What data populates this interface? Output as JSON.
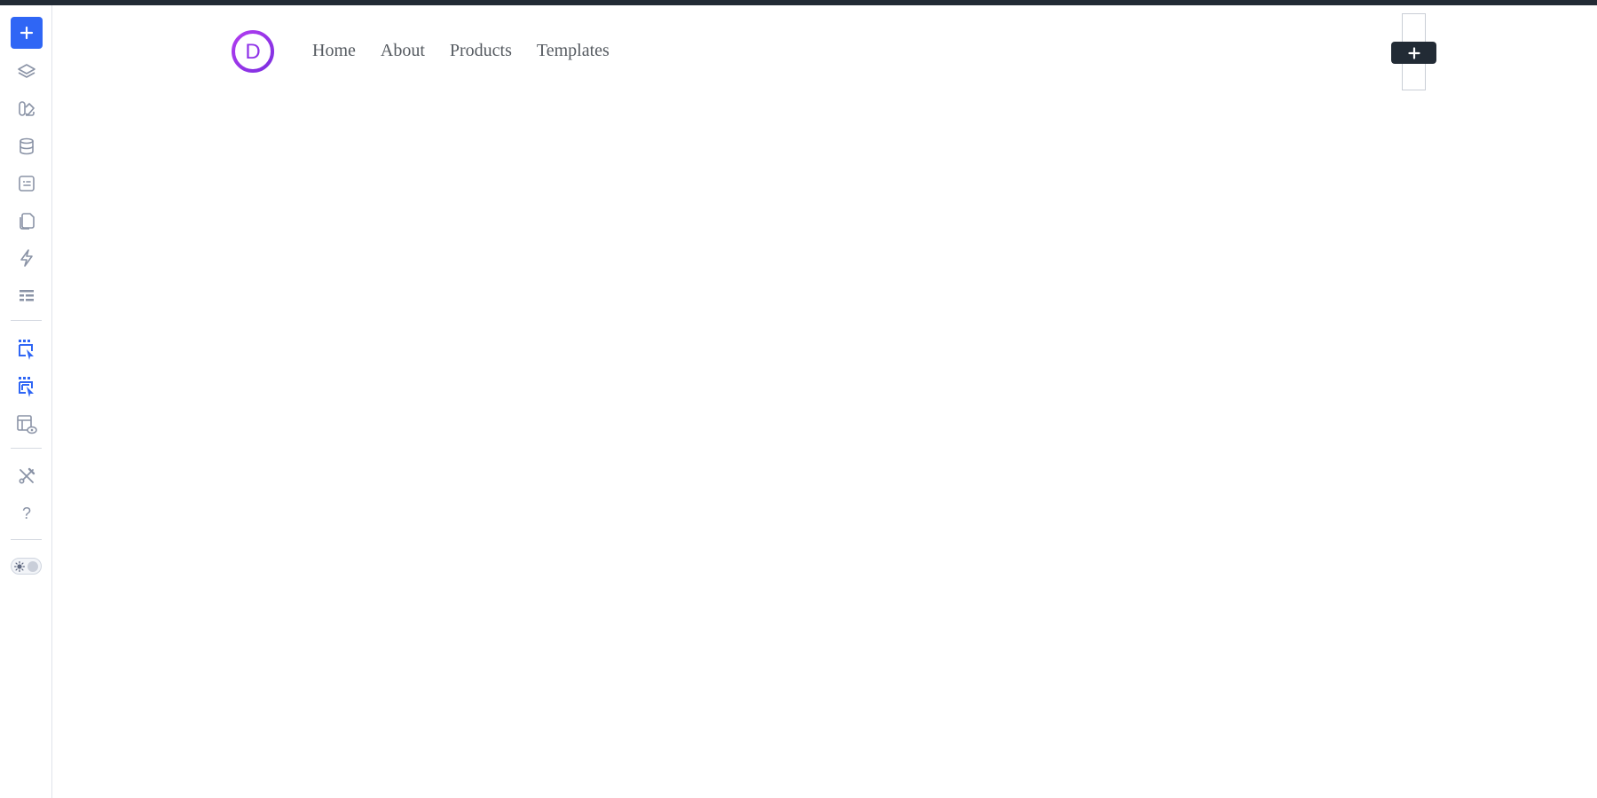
{
  "colors": {
    "accent": "#2f66f5",
    "topbar": "#222b35",
    "icon": "#8a93a6",
    "icon_active": "#2f66f5",
    "logo": "#9b34e6",
    "nav_text": "#555a60"
  },
  "sidebar": {
    "items": [
      {
        "icon": "plus-icon",
        "type": "add"
      },
      {
        "icon": "layers-icon"
      },
      {
        "icon": "library-icon"
      },
      {
        "icon": "database-icon"
      },
      {
        "icon": "form-icon"
      },
      {
        "icon": "pages-icon"
      },
      {
        "icon": "lightning-icon"
      },
      {
        "icon": "menu-list-icon"
      },
      {
        "icon": "select-element-icon",
        "active": true
      },
      {
        "icon": "select-all-icon",
        "active": true
      },
      {
        "icon": "layout-preview-icon"
      },
      {
        "icon": "tools-icon"
      },
      {
        "icon": "help-icon",
        "label": "?"
      },
      {
        "icon": "theme-toggle-icon"
      }
    ]
  },
  "header": {
    "logo_letter": "D",
    "nav": [
      "Home",
      "About",
      "Products",
      "Templates"
    ]
  },
  "column": {
    "insert_icon": "plus-icon"
  }
}
